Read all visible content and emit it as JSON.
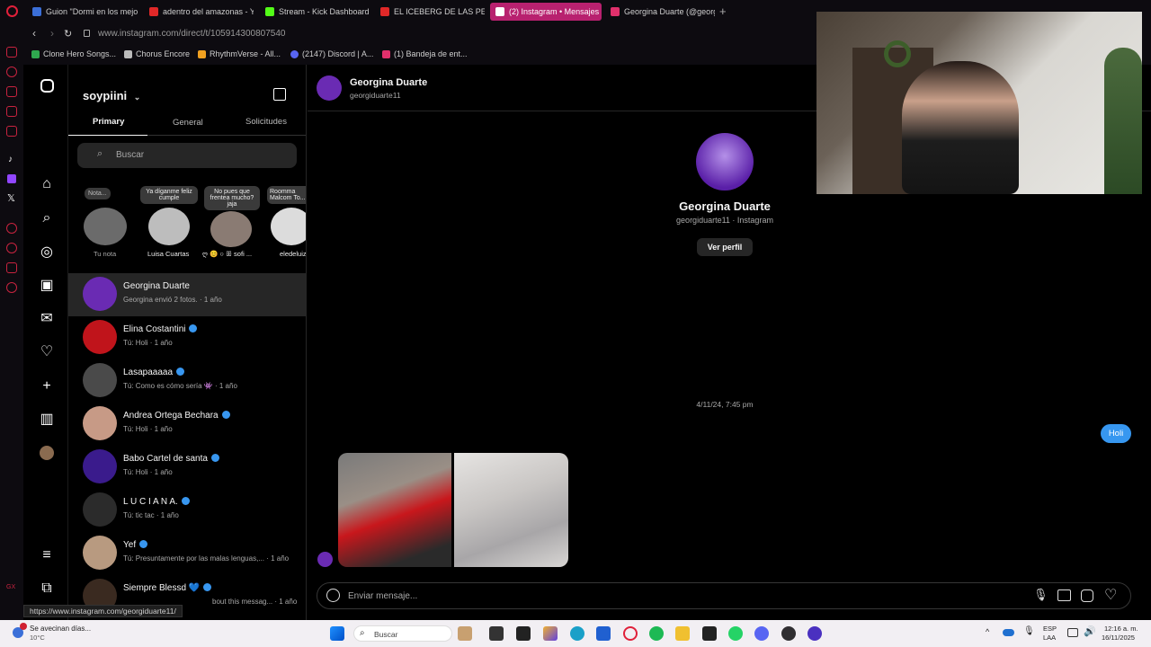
{
  "tabs": [
    {
      "label": "Guion \"Dormi en los mejo",
      "color": "#3b6fd8"
    },
    {
      "label": "adentro del amazonas - Y",
      "color": "#e02828"
    },
    {
      "label": "Stream - Kick Dashboard",
      "color": "#53fc18"
    },
    {
      "label": "EL ICEBERG DE LAS PELÍ",
      "color": "#e02828"
    },
    {
      "label": "(2) Instagram • Mensajes",
      "color": "#e1306c"
    },
    {
      "label": "Georgina Duarte (@georg",
      "color": "#e1306c"
    }
  ],
  "address": "www.instagram.com/direct/t/105914300807540",
  "bookmarks": [
    {
      "label": "Clone Hero Songs...",
      "color": "#2fa84f"
    },
    {
      "label": "Chorus Encore",
      "color": "#bbbbbb"
    },
    {
      "label": "RhythmVerse - All...",
      "color": "#f0a020"
    },
    {
      "label": "(2147) Discord | A...",
      "color": "#5865f2"
    },
    {
      "label": "(1) Bandeja de ent...",
      "color": "#e1306c"
    }
  ],
  "inbox": {
    "username": "soypiini",
    "tabs": [
      "Primary",
      "General",
      "Solicitudes"
    ],
    "search_placeholder": "Buscar",
    "notes": [
      {
        "bubble": "Nota...",
        "name": "Tu nota",
        "color": "#6b6b6b"
      },
      {
        "bubble": "Ya díganme feliz cumple",
        "name": "Luisa Cuartas",
        "color": "#bdbdbd"
      },
      {
        "bubble": "No pues que frentea mucho? jaja",
        "name": "ღ 😊 ○ ꕥ sofi ...",
        "color": "#8a7b73"
      },
      {
        "bubble": "Roomma Malcom To...",
        "name": "eledeluiz",
        "color": "#dcdcdc"
      }
    ],
    "conversations": [
      {
        "name": "Georgina Duarte",
        "preview": "Georgina envió 2 fotos. · 1 año",
        "verified": false,
        "color": "#6a2bb3"
      },
      {
        "name": "Elina Costantini",
        "preview": "Tú: Holi · 1 año",
        "verified": true,
        "color": "#c0141b"
      },
      {
        "name": "Lasapaaaaa",
        "preview": "Tú: Como es cómo sería 👾 · 1 año",
        "verified": true,
        "color": "#4a4a4a"
      },
      {
        "name": "Andrea Ortega Bechara",
        "preview": "Tú: Holi · 1 año",
        "verified": true,
        "color": "#c79a86"
      },
      {
        "name": "Babo Cartel de santa",
        "preview": "Tú: Holi · 1 año",
        "verified": true,
        "color": "#3a1b8c"
      },
      {
        "name": "L U C I A N A.",
        "preview": "Tú: tic tac · 1 año",
        "verified": true,
        "color": "#2b2b2b"
      },
      {
        "name": "Yef",
        "preview": "Tú: Presuntamente por las malas lenguas,... · 1 año",
        "verified": true,
        "color": "#b89a80"
      },
      {
        "name": "Siempre Blessd 💙",
        "preview": "bout this messag... · 1 año",
        "verified": true,
        "color": "#3a2a20"
      }
    ]
  },
  "chat": {
    "header_name": "Georgina Duarte",
    "header_user": "georgiduarte11",
    "profile_name": "Georgina Duarte",
    "profile_sub": "georgiduarte11 · Instagram",
    "view_profile": "Ver perfil",
    "timestamp": "4/11/24, 7:45 pm",
    "sent_message": "Holi",
    "input_placeholder": "Enviar mensaje..."
  },
  "status_url": "https://www.instagram.com/georgiduarte11/",
  "taskbar": {
    "weather_title": "Se avecinan días...",
    "weather_temp": "10°C",
    "search": "Buscar",
    "lang1": "ESP",
    "lang2": "LAA",
    "time": "12:16 a. m.",
    "date": "16/11/2025"
  },
  "colors": {
    "accent_blue": "#3797f0",
    "tab_active": "#b8216f"
  }
}
